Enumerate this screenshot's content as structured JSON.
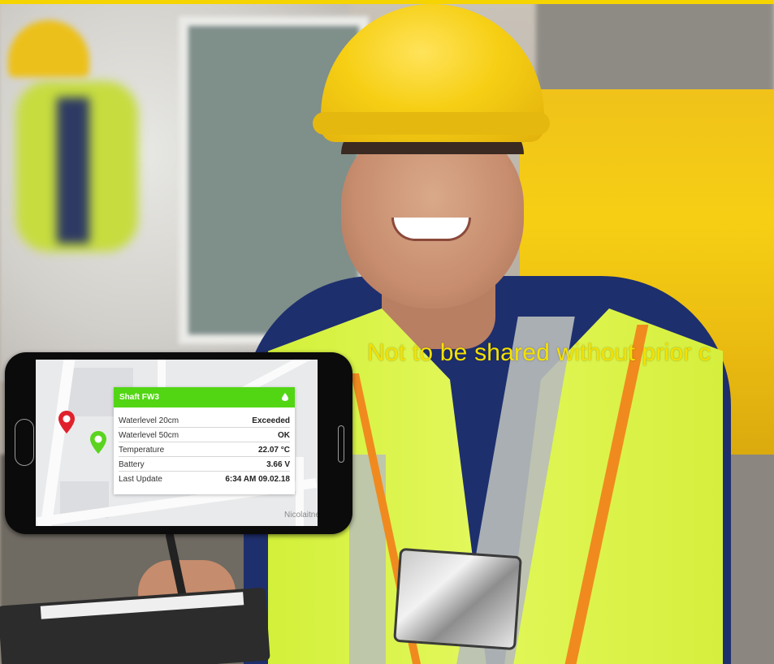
{
  "watermark": {
    "text": "Not to be shared without prior c"
  },
  "map": {
    "street_label": "Nicolaitne"
  },
  "device_card": {
    "title": "Shaft FW3",
    "header_color": "#52d614",
    "rows": [
      {
        "label": "Waterlevel 20cm",
        "value": "Exceeded"
      },
      {
        "label": "Waterlevel 50cm",
        "value": "OK"
      },
      {
        "label": "Temperature",
        "value": "22.07 °C"
      },
      {
        "label": "Battery",
        "value": "3.66 V"
      },
      {
        "label": "Last Update",
        "value": "6:34 AM 09.02.18"
      }
    ]
  },
  "pins": [
    {
      "icon": "red-map-pin-icon",
      "color": "#e0212b"
    },
    {
      "icon": "green-map-pin-icon",
      "color": "#5ad41e"
    }
  ]
}
